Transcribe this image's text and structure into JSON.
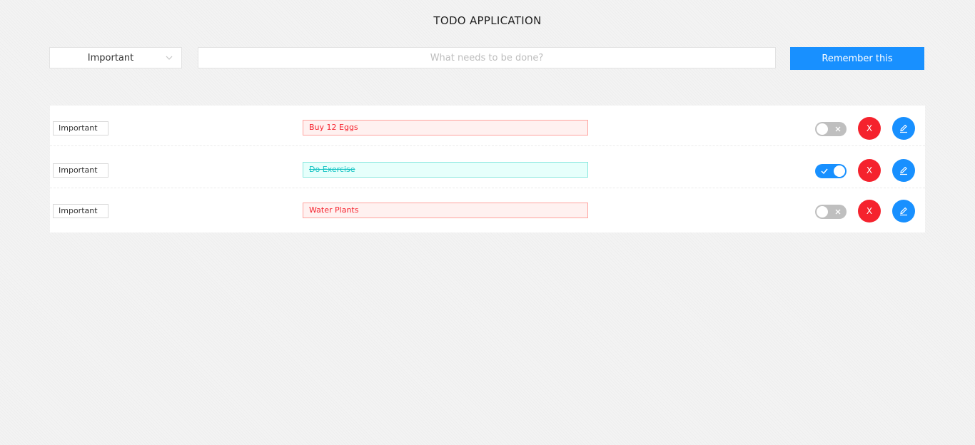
{
  "header": {
    "title": "TODO APPLICATION"
  },
  "form": {
    "type_select": {
      "value": "Important"
    },
    "todo_input": {
      "placeholder": "What needs to be done?",
      "value": ""
    },
    "submit_label": "Remember this"
  },
  "todos": [
    {
      "tag": "Important",
      "text": "Buy 12 Eggs",
      "done": false,
      "delete_label": "X"
    },
    {
      "tag": "Important",
      "text": "Do Exercise",
      "done": true,
      "delete_label": "X"
    },
    {
      "tag": "Important",
      "text": "Water Plants",
      "done": false,
      "delete_label": "X"
    }
  ],
  "colors": {
    "primary": "#1890ff",
    "danger": "#f5222d",
    "toggle_off": "#bfbfbf",
    "done_text": "#13c2c2",
    "pending_text": "#f5222d"
  },
  "icons": {
    "select_caret": "chevron-down-icon",
    "toggle_off": "close-icon",
    "toggle_on": "check-icon",
    "edit": "edit-icon"
  }
}
